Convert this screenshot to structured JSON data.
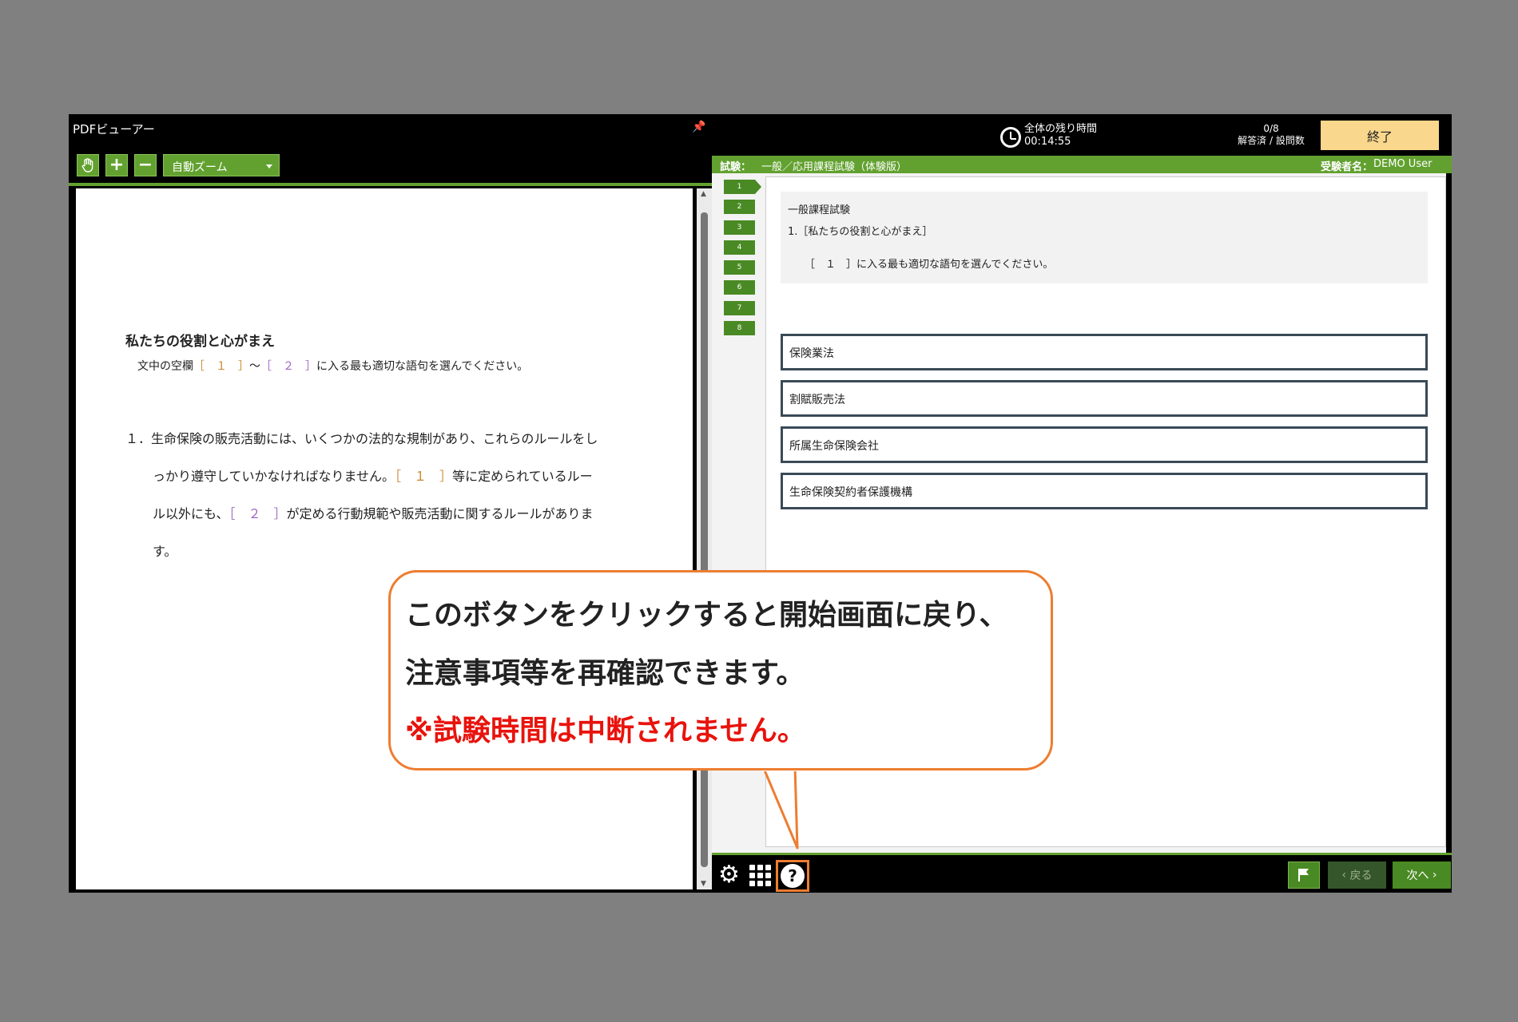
{
  "pdf_viewer": {
    "title": "PDFビューアー",
    "zoom_value": "自動ズーム",
    "document": {
      "heading": "私たちの役割と心がまえ",
      "instruction_prefix": "文中の空欄",
      "instruction_blank1": "［　１　］",
      "instruction_tilde": "～",
      "instruction_blank2": "［　２　］",
      "instruction_suffix": "に入る最も適切な語句を選んでください。",
      "para_number": "１．",
      "para_part1": "生命保険の販売活動には、いくつかの法的な規制があり、これらのルールをし",
      "para_part2": "っかり遵守していかなければなりません。",
      "para_blank1": "［　１　］",
      "para_part3": "等に定められているルー",
      "para_part4": "ル以外にも、",
      "para_blank2": "［　２　］",
      "para_part5": "が定める行動規範や販売活動に関するルールがありま",
      "para_part6": "す。"
    }
  },
  "exam": {
    "time_label": "全体の残り時間",
    "time_value": "00:14:55",
    "answered_count": "0/8",
    "answered_label": "解答済 / 設問数",
    "end_label": "終了",
    "exam_label": "試験：",
    "exam_name": "一般／応用課程試験（体験版）",
    "examinee_label": "受験者名：",
    "examinee_name": "DEMO User",
    "question_numbers": [
      "1",
      "2",
      "3",
      "4",
      "5",
      "6",
      "7",
      "8"
    ],
    "question": {
      "category": "一般課程試験",
      "title": "1.［私たちの役割と心がまえ］",
      "prompt": "［　１　］に入る最も適切な語句を選んでください。"
    },
    "choices": [
      "保険業法",
      "割賦販売法",
      "所属生命保険会社",
      "生命保険契約者保護機構"
    ],
    "back_label": "戻る",
    "next_label": "次へ"
  },
  "callout": {
    "line1": "このボタンをクリックすると開始画面に戻り、",
    "line2": "注意事項等を再確認できます。",
    "line3": "※試験時間は中断されません。"
  },
  "colors": {
    "accent_green": "#62a12f",
    "callout_border": "#ed7d31",
    "warning_red": "#e8130c",
    "end_button": "#f9d78c"
  }
}
